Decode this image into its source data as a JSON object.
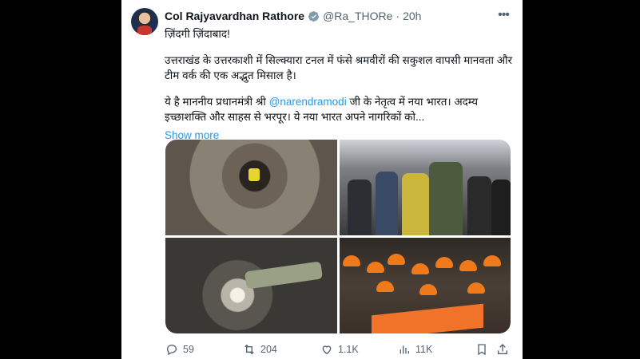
{
  "tweet": {
    "author_name": "Col Rajyavardhan Rathore",
    "handle": "@Ra_THORe",
    "separator": "·",
    "time": "20h",
    "text_line1": "ज़िंदगी ज़िंदाबाद!",
    "text_para2": "उत्तराखंड के उत्तरकाशी में सिल्क्यारा टनल में फंसे श्रमवीरों की सकुशल वापसी मानवता और टीम वर्क की एक अद्भुत मिसाल है।",
    "text_para3_before": "ये है माननीय प्रधानमंत्री श्री ",
    "mention": "@narendramodi",
    "text_para3_after": " जी के नेतृत्व में नया भारत। अदम्य इच्छाशक्ति और साहस से भरपूर। ये नया भारत अपने नागरिकों को...",
    "show_more": "Show more",
    "icons": {
      "verified": "verified-badge-icon",
      "more": "more-options-icon"
    }
  },
  "actions": {
    "replies": "59",
    "reposts": "204",
    "likes": "1.1K",
    "views": "11K"
  },
  "colors": {
    "accent": "#1d9bf0",
    "secondary_text": "#536471",
    "primary_text": "#0f1419"
  }
}
